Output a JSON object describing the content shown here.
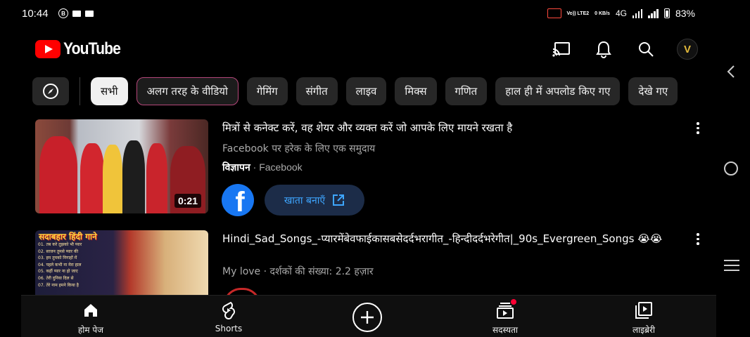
{
  "status_bar": {
    "time": "10:44",
    "network": "4G",
    "volte": "Vo)) LTE2",
    "speed": "0 KB/s",
    "battery": "83%"
  },
  "header": {
    "app_name": "YouTube",
    "icons": [
      "cast-icon",
      "notifications-icon",
      "search-icon",
      "avatar"
    ]
  },
  "chips": {
    "items": [
      {
        "label": "सभी",
        "active": true
      },
      {
        "label": "अलग तरह के वीडियो"
      },
      {
        "label": "गेमिंग"
      },
      {
        "label": "संगीत"
      },
      {
        "label": "लाइव"
      },
      {
        "label": "मिक्स"
      },
      {
        "label": "गणित"
      },
      {
        "label": "हाल ही में अपलोड किए गए"
      },
      {
        "label": "देखे गए"
      }
    ]
  },
  "ad": {
    "title": "मित्रों से कनेक्ट करें, वह शेयर और व्यक्त करें जो आपके लिए मायने रखता है",
    "subtitle": "Facebook पर हरेक के लिए एक समुदाय",
    "badge": "विज्ञापन",
    "separator": "·",
    "advertiser": "Facebook",
    "duration": "0:21",
    "cta": "खाता बनाएँ"
  },
  "video": {
    "title": "Hindi_Sad_Songs_-प्यारमेंबेवफाईकासबसेदर्दभरागीत_-हिन्दीदर्दभरेगीत|_90s_Evergreen_Songs 😭😭",
    "meta": "My love · दर्शकों की संख्या: 2.2 हज़ार",
    "thumb_title": "सदाबहार हिंदी गाने",
    "thumb_list": [
      "01. तब करे तुझको भी प्यार",
      "02. साजन तुमसे प्यार की",
      "03. हम तुमको निगाहों में",
      "04. पहले कभी ना मेरा हाल",
      "05. कहीं प्यार ना हो जाए",
      "06. तेरी दुनिया दिल से",
      "07. तेरे नाम हमने किया है"
    ]
  },
  "bottom_nav": {
    "home": "होम पेज",
    "shorts": "Shorts",
    "subscriptions": "सदस्यता",
    "library": "लाइब्रेरी"
  }
}
